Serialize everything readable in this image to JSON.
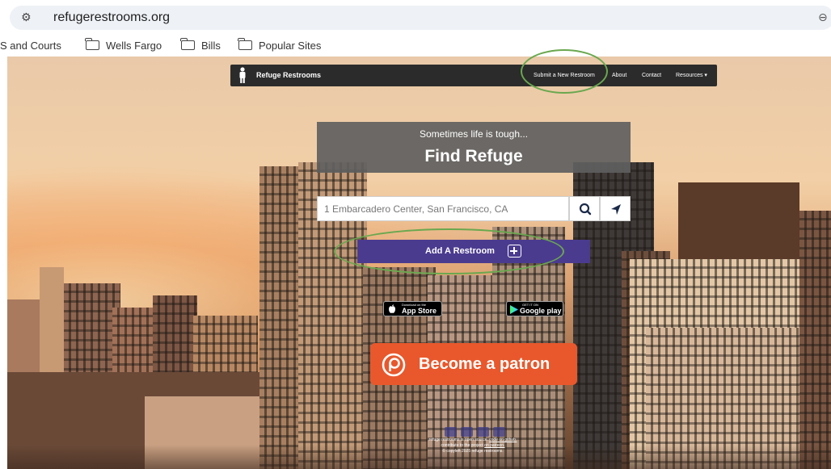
{
  "browser": {
    "url": "refugerestrooms.org",
    "bookmarks": [
      "S and Courts",
      "Wells Fargo",
      "Bills",
      "Popular Sites"
    ]
  },
  "navbar": {
    "brand": "Refuge Restrooms",
    "links": [
      "Submit a New Restroom",
      "About",
      "Contact",
      "Resources ▾"
    ]
  },
  "hero": {
    "subtitle": "Sometimes life is tough...",
    "title": "Find Refuge"
  },
  "search": {
    "placeholder": "1 Embarcadero Center, San Francisco, CA"
  },
  "add_restroom_label": "Add A Restroom",
  "app_store": {
    "small": "Download on the",
    "big": "App Store"
  },
  "google_play": {
    "small": "GET IT ON",
    "big": "Google play"
  },
  "patron_label": "Become a patron",
  "footer": {
    "line1_text": "refuge restrooms is open source.",
    "line1_link": "code on github.",
    "line2_text": "contribute to the project",
    "line2_link": "on patreon.",
    "line3": "© copyleft 2025 refuge restrooms."
  },
  "colors": {
    "navbar": "#2b2b2b",
    "add_button": "#4b3b8f",
    "patron": "#e8582c",
    "annotation": "#6aa84f"
  },
  "icons": [
    "site-settings-icon",
    "folder-icon",
    "person-icon",
    "search-icon",
    "location-arrow-icon",
    "plus-icon",
    "apple-icon",
    "google-play-icon",
    "patreon-icon"
  ]
}
